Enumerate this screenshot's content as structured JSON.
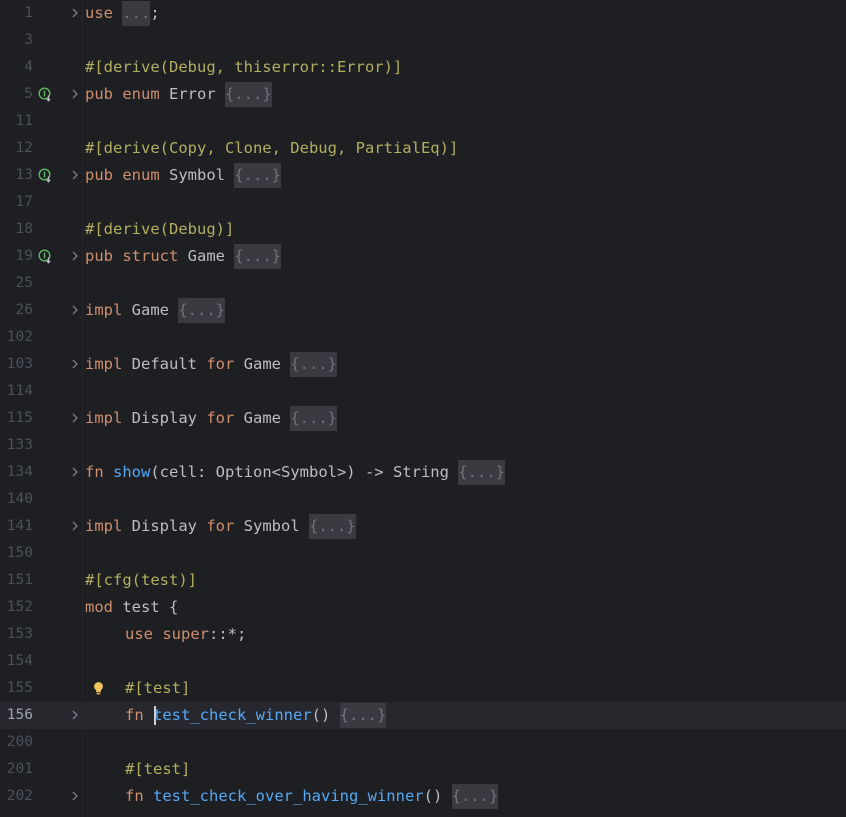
{
  "editor": {
    "lines": [
      {
        "num": "1",
        "tokens": [
          {
            "t": "use",
            "c": "kw"
          },
          {
            "t": " "
          },
          {
            "t": "...",
            "c": "fold-chip"
          },
          {
            "t": ";"
          }
        ],
        "fold": true
      },
      {
        "num": "3",
        "tokens": []
      },
      {
        "num": "4",
        "tokens": [
          {
            "t": "#[derive(Debug, thiserror::Error)]",
            "c": "attr"
          }
        ]
      },
      {
        "num": "5",
        "tokens": [
          {
            "t": "pub",
            "c": "kw"
          },
          {
            "t": " "
          },
          {
            "t": "enum",
            "c": "kw"
          },
          {
            "t": " Error "
          },
          {
            "t": "{...}",
            "c": "fold-chip"
          }
        ],
        "fold": true,
        "gutter_icon": "implemented-icon"
      },
      {
        "num": "11",
        "tokens": []
      },
      {
        "num": "12",
        "tokens": [
          {
            "t": "#[derive(Copy, Clone, Debug, PartialEq)]",
            "c": "attr"
          }
        ]
      },
      {
        "num": "13",
        "tokens": [
          {
            "t": "pub",
            "c": "kw"
          },
          {
            "t": " "
          },
          {
            "t": "enum",
            "c": "kw"
          },
          {
            "t": " Symbol "
          },
          {
            "t": "{...}",
            "c": "fold-chip"
          }
        ],
        "fold": true,
        "gutter_icon": "implemented-icon"
      },
      {
        "num": "17",
        "tokens": []
      },
      {
        "num": "18",
        "tokens": [
          {
            "t": "#[derive(Debug)]",
            "c": "attr"
          }
        ]
      },
      {
        "num": "19",
        "tokens": [
          {
            "t": "pub",
            "c": "kw"
          },
          {
            "t": " "
          },
          {
            "t": "struct",
            "c": "kw"
          },
          {
            "t": " Game "
          },
          {
            "t": "{...}",
            "c": "fold-chip"
          }
        ],
        "fold": true,
        "gutter_icon": "implemented-icon"
      },
      {
        "num": "25",
        "tokens": []
      },
      {
        "num": "26",
        "tokens": [
          {
            "t": "impl",
            "c": "kw"
          },
          {
            "t": " Game "
          },
          {
            "t": "{...}",
            "c": "fold-chip"
          }
        ],
        "fold": true
      },
      {
        "num": "102",
        "tokens": []
      },
      {
        "num": "103",
        "tokens": [
          {
            "t": "impl",
            "c": "kw"
          },
          {
            "t": " Default "
          },
          {
            "t": "for",
            "c": "kw"
          },
          {
            "t": " Game "
          },
          {
            "t": "{...}",
            "c": "fold-chip"
          }
        ],
        "fold": true
      },
      {
        "num": "114",
        "tokens": []
      },
      {
        "num": "115",
        "tokens": [
          {
            "t": "impl",
            "c": "kw"
          },
          {
            "t": " Display "
          },
          {
            "t": "for",
            "c": "kw"
          },
          {
            "t": " Game "
          },
          {
            "t": "{...}",
            "c": "fold-chip"
          }
        ],
        "fold": true
      },
      {
        "num": "133",
        "tokens": []
      },
      {
        "num": "134",
        "tokens": [
          {
            "t": "fn",
            "c": "kw"
          },
          {
            "t": " "
          },
          {
            "t": "show",
            "c": "fn"
          },
          {
            "t": "(cell: Option<Symbol>) -> String "
          },
          {
            "t": "{...}",
            "c": "fold-chip"
          }
        ],
        "fold": true
      },
      {
        "num": "140",
        "tokens": []
      },
      {
        "num": "141",
        "tokens": [
          {
            "t": "impl",
            "c": "kw"
          },
          {
            "t": " Display "
          },
          {
            "t": "for",
            "c": "kw"
          },
          {
            "t": " Symbol "
          },
          {
            "t": "{...}",
            "c": "fold-chip"
          }
        ],
        "fold": true
      },
      {
        "num": "150",
        "tokens": []
      },
      {
        "num": "151",
        "tokens": [
          {
            "t": "#[cfg(test)]",
            "c": "attr"
          }
        ]
      },
      {
        "num": "152",
        "tokens": [
          {
            "t": "mod",
            "c": "kw"
          },
          {
            "t": " test {"
          }
        ]
      },
      {
        "num": "153",
        "indent": true,
        "tokens": [
          {
            "t": "use",
            "c": "kw"
          },
          {
            "t": " "
          },
          {
            "t": "super",
            "c": "kw"
          },
          {
            "t": "::*;"
          }
        ]
      },
      {
        "num": "154",
        "tokens": []
      },
      {
        "num": "155",
        "indent": true,
        "tokens": [
          {
            "t": "#[test]",
            "c": "attr"
          }
        ],
        "gutter_icon": "lightbulb-icon"
      },
      {
        "num": "156",
        "indent": true,
        "current": true,
        "caret": true,
        "tokens": [
          {
            "t": "fn",
            "c": "kw"
          },
          {
            "t": " "
          },
          {
            "t": "test_check_winner",
            "c": "fn"
          },
          {
            "t": "() "
          },
          {
            "t": "{...}",
            "c": "fold-chip"
          }
        ],
        "fold": true
      },
      {
        "num": "200",
        "tokens": []
      },
      {
        "num": "201",
        "indent": true,
        "tokens": [
          {
            "t": "#[test]",
            "c": "attr"
          }
        ]
      },
      {
        "num": "202",
        "indent": true,
        "tokens": [
          {
            "t": "fn",
            "c": "kw"
          },
          {
            "t": " "
          },
          {
            "t": "test_check_over_having_winner",
            "c": "fn"
          },
          {
            "t": "() "
          },
          {
            "t": "{...}",
            "c": "fold-chip"
          }
        ],
        "fold": true
      }
    ]
  }
}
